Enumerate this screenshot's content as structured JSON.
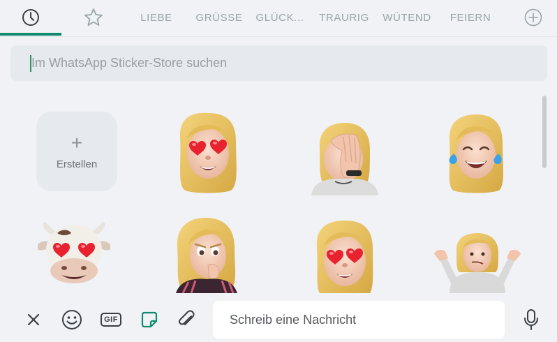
{
  "tabs": {
    "recent_icon": "clock-icon",
    "favorites_icon": "star-icon",
    "categories": [
      "LIEBE",
      "GRÜSSE",
      "GLÜCK...",
      "TRAURIG",
      "WÜTEND",
      "FEIERN"
    ],
    "add_icon": "plus-circle-icon",
    "active_color": "#0e8a6f"
  },
  "search": {
    "placeholder": "Im WhatsApp Sticker-Store suchen"
  },
  "grid": {
    "create_label": "Erstellen",
    "stickers": [
      "memoji-heart-eyes",
      "memoji-facepalm",
      "memoji-tears-of-joy",
      "cow-heart-eyes",
      "memoji-nervous",
      "memoji-heart-eyes-2",
      "memoji-shrug"
    ]
  },
  "composer": {
    "close_icon": "close-icon",
    "emoji_icon": "smiley-icon",
    "gif_label": "GIF",
    "sticker_icon": "sticker-icon",
    "attach_icon": "paperclip-icon",
    "placeholder": "Schreib eine Nachricht",
    "mic_icon": "microphone-icon"
  }
}
